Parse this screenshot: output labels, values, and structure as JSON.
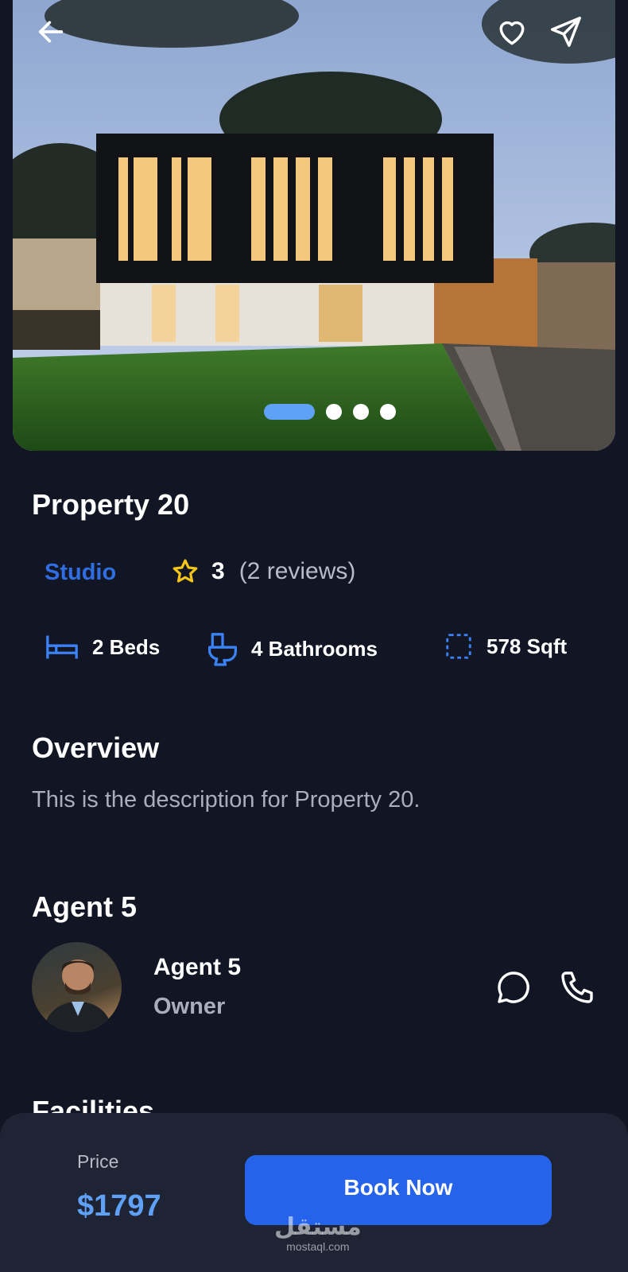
{
  "property": {
    "title": "Property 20",
    "type": "Studio",
    "rating": "3",
    "reviews": "(2 reviews)",
    "carousel": {
      "total": 4,
      "active_index": 0
    }
  },
  "features": {
    "beds": "2 Beds",
    "bathrooms": "4 Bathrooms",
    "area": "578 Sqft"
  },
  "overview": {
    "heading": "Overview",
    "description": "This is the description for Property 20."
  },
  "agent": {
    "heading": "Agent 5",
    "name": "Agent 5",
    "role": "Owner"
  },
  "facilities": {
    "heading": "Facilities"
  },
  "booking": {
    "price_label": "Price",
    "price": "$1797",
    "button_label": "Book Now"
  },
  "watermark": {
    "arabic": "مستقل",
    "latin": "mostaql.com"
  },
  "icons": {
    "back": "arrow-left-icon",
    "favorite": "heart-icon",
    "share": "send-icon",
    "star": "star-icon",
    "bed": "bed-icon",
    "bath": "toilet-icon",
    "area": "area-icon",
    "chat": "chat-icon",
    "phone": "phone-icon"
  },
  "colors": {
    "background": "#121624",
    "accent": "#2563eb",
    "price": "#5ea1f6",
    "type": "#2f6de0",
    "star": "#f5c518",
    "muted": "#a9aebb"
  }
}
